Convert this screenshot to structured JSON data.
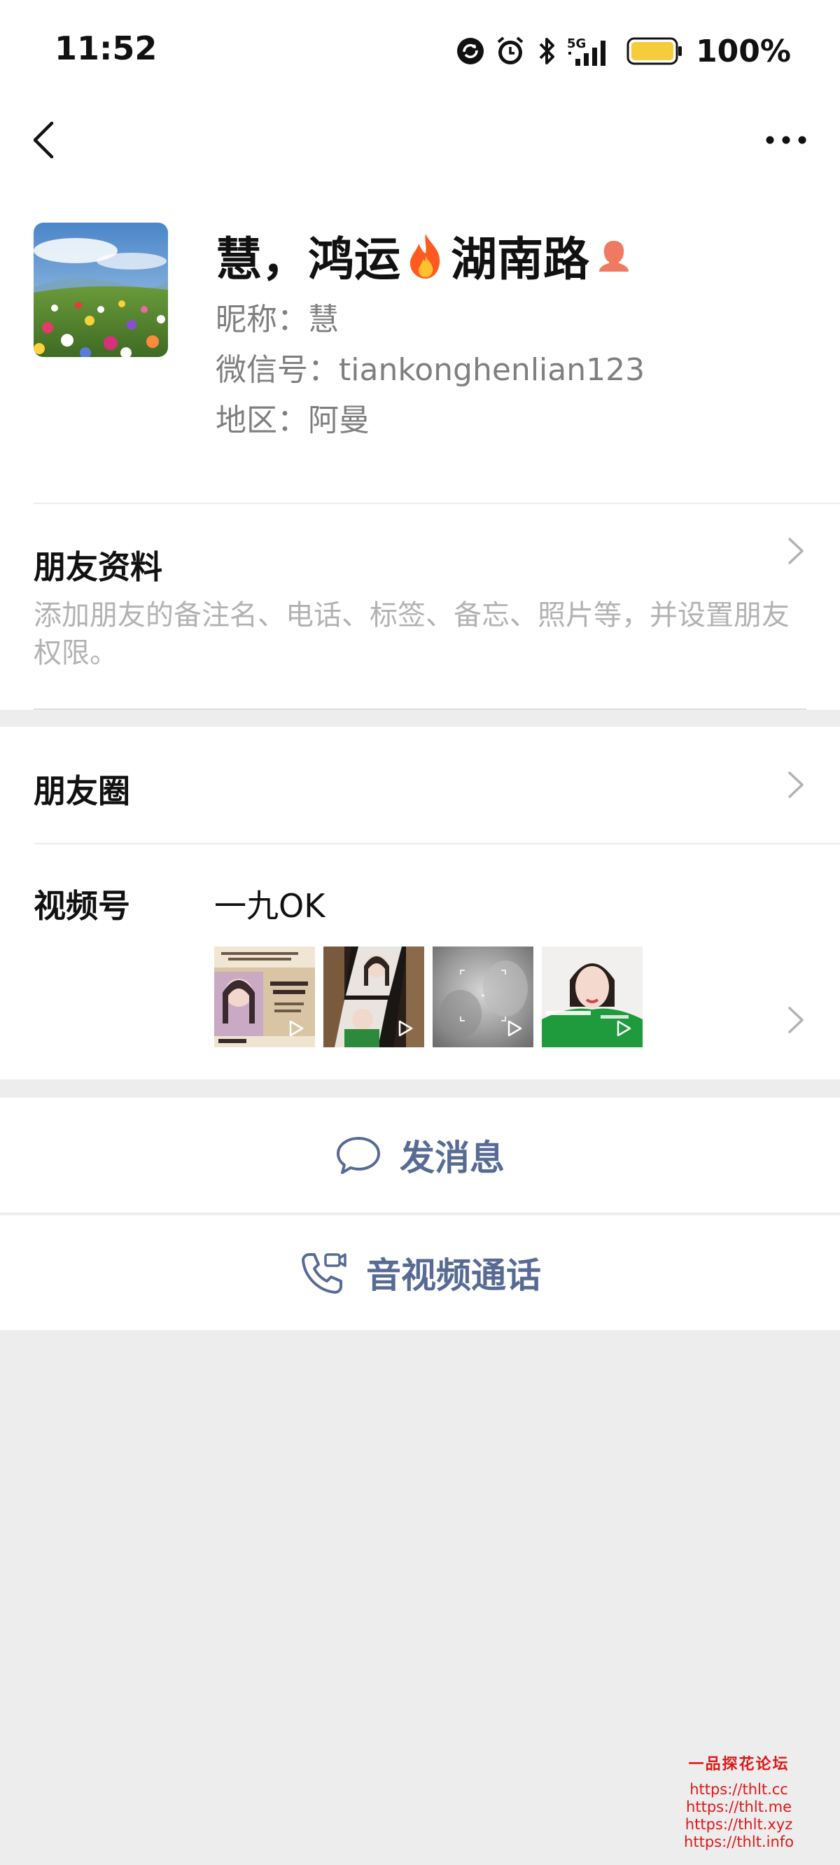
{
  "status_bar": {
    "time": "11:52",
    "network": "5G",
    "battery": "100%",
    "icons": [
      "sync-icon",
      "alarm-icon",
      "bluetooth-icon",
      "signal-icon",
      "battery-icon"
    ]
  },
  "nav": {
    "back_icon": "chevron-left-icon",
    "more_icon": "ellipsis-icon"
  },
  "profile": {
    "name_part1": "慧，鸿运",
    "name_part2": "湖南路",
    "name_emoji": "fire-icon",
    "gender_icon": "female-icon",
    "nickname": "昵称：慧",
    "wechat_id": "微信号：tiankonghenlian123",
    "region": "地区：阿曼"
  },
  "friend_info": {
    "title": "朋友资料",
    "description": "添加朋友的备注名、电话、标签、备忘、照片等，并设置朋友权限。"
  },
  "moments": {
    "title": "朋友圈"
  },
  "channels": {
    "title": "视频号",
    "name": "一九OK",
    "thumbs": [
      "video-thumb-1",
      "video-thumb-2",
      "video-thumb-3",
      "video-thumb-4"
    ]
  },
  "actions": {
    "send_message": "发消息",
    "av_call": "音视频通话"
  },
  "watermark": {
    "title": "一品探花论坛",
    "urls": [
      "https://thlt.cc",
      "https://thlt.me",
      "https://thlt.xyz",
      "https://thlt.info"
    ]
  },
  "colors": {
    "link": "#576b95",
    "background": "#ededed",
    "watermark": "#e01818"
  }
}
